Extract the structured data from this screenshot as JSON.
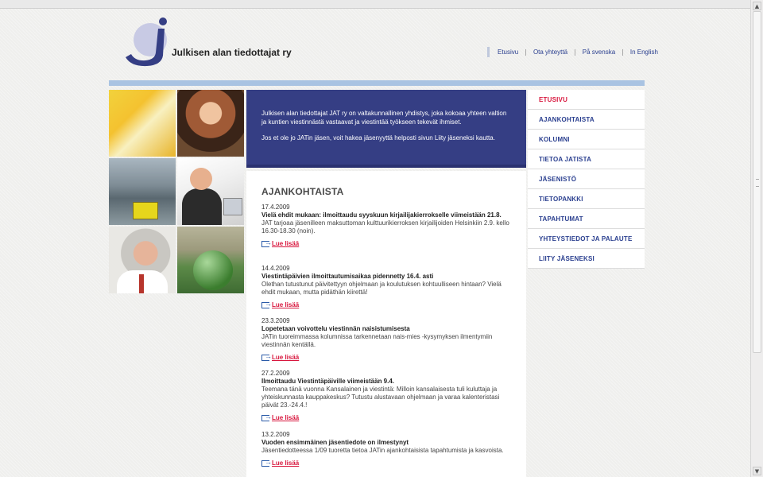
{
  "site": {
    "logo_letter": "j",
    "name": "Julkisen alan tiedottajat ry"
  },
  "top_links": [
    "Etusivu",
    "Ota yhteyttä",
    "På svenska",
    "In English"
  ],
  "intro": {
    "paragraph1": "Julkisen alan tiedottajat JAT ry on valtakunnallinen yhdistys, joka kokoaa yhteen valtion ja kuntien viestinnästä vastaavat ja viestintää työkseen tekevät ihmiset.",
    "paragraph2": "Jos et ole jo JATin jäsen, voit hakea jäsenyyttä helposti sivun Liity jäseneksi kautta."
  },
  "section_title": "AJANKOHTAISTA",
  "read_more_label": "Lue lisää",
  "news": [
    {
      "date": "17.4.2009",
      "title": "Vielä ehdit mukaan: ilmoittaudu syyskuun kirjailijakierrokselle viimeistään 21.8.",
      "body": "JAT tarjoaa jäsenilleen maksuttoman kulttuurikierroksen kirjailijoiden Helsinkiin 2.9. kello 16.30-18.30 (noin)."
    },
    {
      "date": "14.4.2009",
      "title": "Viestintäpäivien ilmoittautumisaikaa pidennetty 16.4. asti",
      "body": "Olethan tutustunut päivitettyyn ohjelmaan ja koulutuksen kohtuulliseen hintaan? Vielä ehdit mukaan, mutta pidäthän kiirettä!"
    },
    {
      "date": "23.3.2009",
      "title": "Lopetetaan voivottelu viestinnän naisistumisesta",
      "body": "JATin tuoreimmassa kolumnissa tarkennetaan nais-mies -kysymyksen ilmentymiin viestinnän kentällä."
    },
    {
      "date": "27.2.2009",
      "title": "Ilmoittaudu Viestintäpäiville viimeistään 9.4.",
      "body": "Teemana tänä vuonna Kansalainen ja viestintä: Milloin kansalaisesta tuli kuluttaja ja yhteiskunnasta kauppakeskus? Tutustu alustavaan ohjelmaan ja varaa kalenteristasi päivät 23.-24.4.!"
    },
    {
      "date": "13.2.2009",
      "title": "Vuoden ensimmäinen jäsentiedote on ilmestynyt",
      "body": "Jäsentiedotteessa 1/09 tuoretta tietoa JATin ajankohtaisista tapahtumista ja kasvoista."
    }
  ],
  "menu": [
    "ETUSIVU",
    "AJANKOHTAISTA",
    "KOLUMNI",
    "TIETOA JATISTA",
    "JÄSENISTÖ",
    "TIETOPANKKI",
    "TAPAHTUMAT",
    "YHTEYSTIEDOT JA PALAUTE",
    "LIITY JÄSENEKSI"
  ],
  "colors": {
    "brand_navy": "#353e84",
    "accent_red": "#d8163d",
    "link_blue": "#2a3f8f",
    "bar_light_blue": "#a9c3e2"
  },
  "scrollbar": {
    "up_arrow": "▲",
    "down_arrow": "▼"
  }
}
